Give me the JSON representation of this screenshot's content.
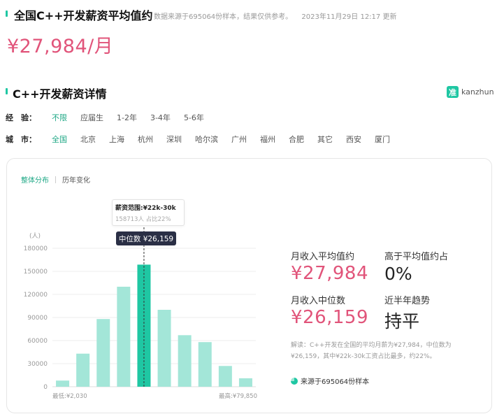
{
  "header": {
    "title": "全国C++开发薪资平均值约",
    "source_note": "数据来源于695064份样本，结果仅供参考。",
    "updated": "2023年11月29日 12:17 更新",
    "avg_salary": "¥27,984/月"
  },
  "section": {
    "title": "C++开发薪资详情",
    "brand_logo": "准",
    "brand_name": "kanzhun"
  },
  "filters": {
    "experience": {
      "label": "经　验：",
      "options": [
        "不限",
        "应届生",
        "1-2年",
        "3-4年",
        "5-6年"
      ],
      "active_index": 0
    },
    "city": {
      "label": "城　市：",
      "options": [
        "全国",
        "北京",
        "上海",
        "杭州",
        "深圳",
        "哈尔滨",
        "广州",
        "福州",
        "合肥",
        "其它",
        "西安",
        "厦门"
      ],
      "active_index": 0
    }
  },
  "tabs": [
    "整体分布",
    "历年变化"
  ],
  "tooltip": {
    "range": "薪资范围:¥22k-30k",
    "detail": "158713人  占比22%",
    "median": "中位数 ¥26,159"
  },
  "chart_data": {
    "type": "bar",
    "y_unit": "(人)",
    "ylim": [
      0,
      180000
    ],
    "yticks": [
      0,
      30000,
      60000,
      90000,
      120000,
      150000,
      180000
    ],
    "ytick_labels": [
      "0",
      "30000",
      "60000",
      "90000",
      "120000",
      "150000",
      "180000"
    ],
    "values": [
      8000,
      43000,
      88000,
      130000,
      158713,
      100000,
      67000,
      58000,
      27000,
      11000
    ],
    "highlight_index": 4,
    "x_start_label": "最低:¥2,030",
    "x_end_label": "最高:¥79,850",
    "colors": {
      "bar": "#a3e6d8",
      "highlight": "#1fc7a3",
      "grid": "#eeeeee"
    }
  },
  "stats": {
    "avg_label": "月收入平均值约",
    "avg_value": "¥27,984",
    "above_label": "高于平均值约占",
    "above_value": "0%",
    "median_label": "月收入中位数",
    "median_value": "¥26,159",
    "trend_label": "近半年趋势",
    "trend_value": "持平"
  },
  "description": "解读：C++开发在全国的平均月薪为¥27,984，中位数为¥26,159，其中¥22k-30k工资占比最多，约22%。",
  "source": "来源于695064份样本",
  "colors": {
    "accent": "#1fc7a3",
    "salary": "#e1547a"
  }
}
